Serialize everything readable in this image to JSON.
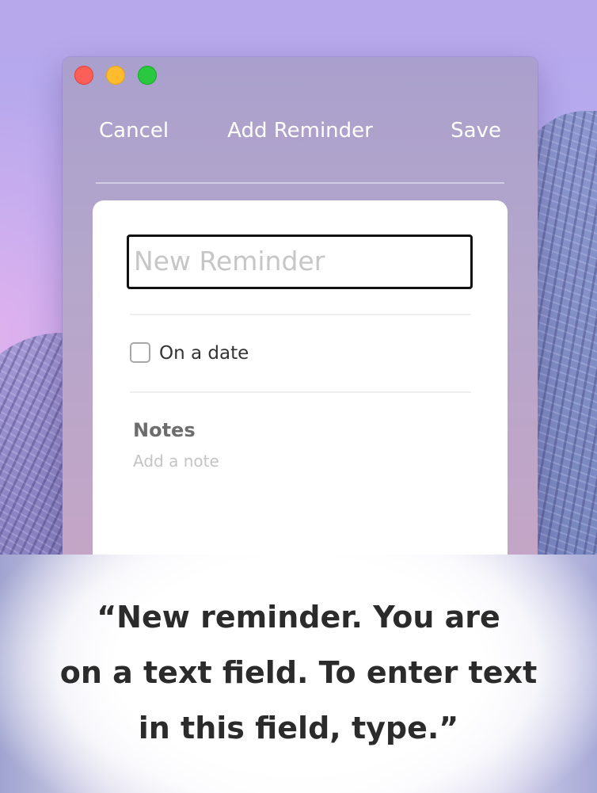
{
  "window": {
    "toolbar": {
      "cancel_label": "Cancel",
      "title": "Add Reminder",
      "save_label": "Save"
    },
    "form": {
      "title_input": {
        "placeholder": "New Reminder",
        "value": ""
      },
      "date_option": {
        "label": "On a date",
        "checked": false
      },
      "notes": {
        "heading": "Notes",
        "placeholder": "Add a note"
      }
    }
  },
  "caption": {
    "text": "“New reminder. You are\non a text field. To enter text\nin this field, type.”"
  },
  "colors": {
    "close": "#fb5f57",
    "minimize": "#febb2e",
    "zoom": "#2ac840",
    "focus_ring": "#111111"
  },
  "icons": [
    "close-icon",
    "minimize-icon",
    "zoom-icon",
    "checkbox-icon"
  ]
}
